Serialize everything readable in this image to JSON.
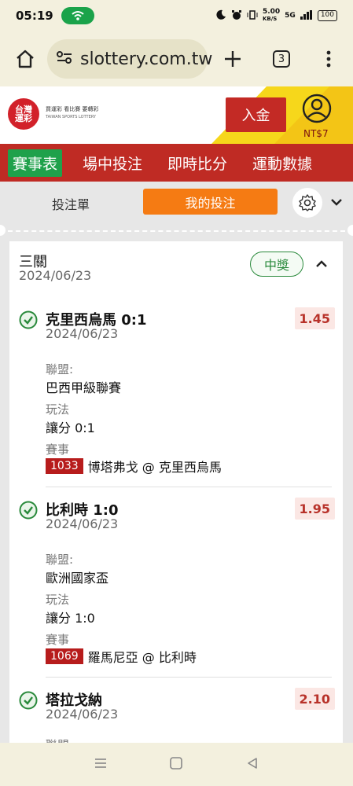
{
  "status_bar": {
    "time": "05:19",
    "net_speed": "5.00",
    "net_unit": "KB/S",
    "signal": "5G",
    "battery": "100"
  },
  "browser": {
    "url": "slottery.com.tw",
    "tab_count": "3"
  },
  "site": {
    "logo_line1": "台灣",
    "logo_line2": "運彩",
    "logo_text": "買運彩 看比賽 要轉彩",
    "logo_sub": "TAIWAN SPORTS LOTTERY",
    "deposit_label": "入金",
    "balance": "NT$7"
  },
  "nav": [
    "賽事表",
    "場中投注",
    "即時比分",
    "運動數據"
  ],
  "bet_tabs": {
    "slip": "投注單",
    "my_bets": "我的投注"
  },
  "bet": {
    "type": "三關",
    "date": "2024/06/23",
    "status": "中獎",
    "legs": [
      {
        "title": "克里西烏馬 0:1",
        "date": "2024/06/23",
        "odds": "1.45",
        "league_label": "聯盟:",
        "league": "巴西甲級聯賽",
        "play_label": "玩法",
        "play": "讓分 0:1",
        "match_label": "賽事",
        "code": "1033",
        "teams": "博塔弗戈 @ 克里西烏馬"
      },
      {
        "title": "比利時 1:0",
        "date": "2024/06/23",
        "odds": "1.95",
        "league_label": "聯盟:",
        "league": "歐洲國家盃",
        "play_label": "玩法",
        "play": "讓分 1:0",
        "match_label": "賽事",
        "code": "1069",
        "teams": "羅馬尼亞 @ 比利時"
      },
      {
        "title": "塔拉戈納",
        "date": "2024/06/23",
        "odds": "2.10",
        "league_label": "聯盟:"
      }
    ]
  },
  "colors": {
    "brand_red": "#bf2b24",
    "accent_orange": "#f57b13",
    "win_green": "#2a8a3c",
    "nav_active": "#1fa14b"
  }
}
